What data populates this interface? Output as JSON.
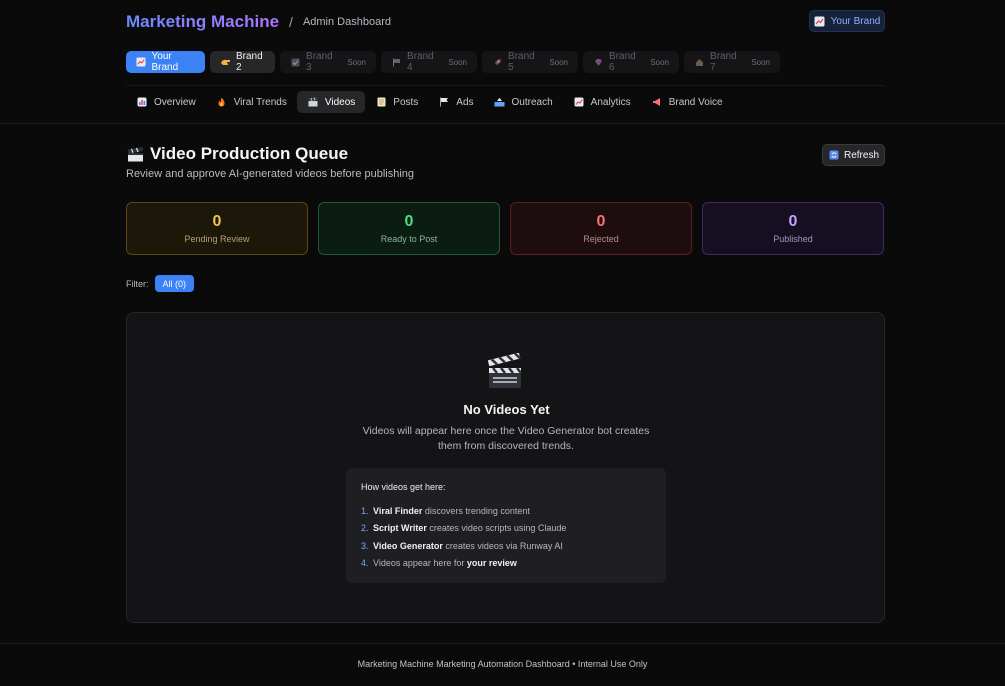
{
  "header": {
    "logo": "Marketing Machine",
    "separator": "/",
    "section": "Admin Dashboard",
    "brand_button": "Your Brand"
  },
  "brand_tabs": [
    {
      "label": "Your Brand",
      "icon": "chart-icon",
      "state": "active"
    },
    {
      "label": "Brand 2",
      "icon": "hand-icon",
      "state": "normal"
    },
    {
      "label": "Brand 3",
      "icon": "checkbox-icon",
      "state": "soon",
      "badge": "Soon"
    },
    {
      "label": "Brand 4",
      "icon": "flag-icon",
      "state": "soon",
      "badge": "Soon"
    },
    {
      "label": "Brand 5",
      "icon": "rocket-icon",
      "state": "soon",
      "badge": "Soon"
    },
    {
      "label": "Brand 6",
      "icon": "gem-icon",
      "state": "soon",
      "badge": "Soon"
    },
    {
      "label": "Brand 7",
      "icon": "house-icon",
      "state": "soon",
      "badge": "Soon"
    }
  ],
  "nav": [
    {
      "label": "Overview",
      "icon": "bar-chart-icon"
    },
    {
      "label": "Viral Trends",
      "icon": "fire-icon"
    },
    {
      "label": "Videos",
      "icon": "clapper-icon",
      "active": true
    },
    {
      "label": "Posts",
      "icon": "memo-icon"
    },
    {
      "label": "Ads",
      "icon": "flag-icon"
    },
    {
      "label": "Outreach",
      "icon": "outbox-icon"
    },
    {
      "label": "Analytics",
      "icon": "chart-up-icon"
    },
    {
      "label": "Brand Voice",
      "icon": "megaphone-icon"
    }
  ],
  "page": {
    "title": "Video Production Queue",
    "subtitle": "Review and approve AI-generated videos before publishing",
    "refresh": "Refresh"
  },
  "stats": [
    {
      "value": "0",
      "label": "Pending Review",
      "kind": "pending"
    },
    {
      "value": "0",
      "label": "Ready to Post",
      "kind": "ready"
    },
    {
      "value": "0",
      "label": "Rejected",
      "kind": "rejected"
    },
    {
      "value": "0",
      "label": "Published",
      "kind": "published"
    }
  ],
  "filter": {
    "label": "Filter:",
    "chip": "All (0)"
  },
  "empty": {
    "title": "No Videos Yet",
    "desc": "Videos will appear here once the Video Generator bot creates them from discovered trends.",
    "howto_title": "How videos get here:",
    "steps": [
      {
        "n": "1.",
        "bold": "Viral Finder",
        "text": " discovers trending content"
      },
      {
        "n": "2.",
        "bold": "Script Writer",
        "text": " creates video scripts using Claude"
      },
      {
        "n": "3.",
        "bold": "Video Generator",
        "text": " creates videos via Runway AI"
      },
      {
        "n": "4.",
        "pre": "Videos appear here for ",
        "bold": "your review",
        "text": ""
      }
    ]
  },
  "footer": "Marketing Machine Marketing Automation Dashboard • Internal Use Only",
  "colors": {
    "accent": "#3b82f6",
    "pending": "#f0c24a",
    "ready": "#4ade80",
    "rejected": "#f87171",
    "published": "#c4a1ff"
  }
}
